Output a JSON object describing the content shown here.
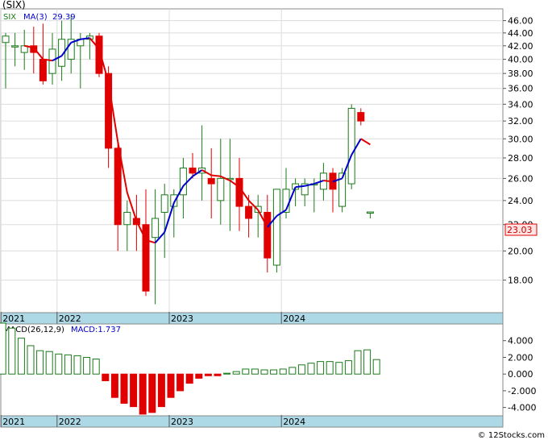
{
  "title": "(SIX)",
  "ma_label": "MA(3)",
  "ma_value": "29.39",
  "last_price_label": "23.03",
  "macd_label": "MACD(26,12,9)",
  "macd_value_label": "MACD:1.737",
  "watermark": "© 12Stocks.com",
  "colors": {
    "up": "#1a7a1a",
    "down": "#e00000",
    "ma_up": "#0000cc",
    "ma_down": "#e00000",
    "axis_band": "#add8e6",
    "grid": "#dcdcdc"
  },
  "chart_data": [
    {
      "type": "candlestick",
      "series_name": "SIX",
      "x_labels": [
        "2021",
        "2022",
        "2023",
        "2024"
      ],
      "x_label_index": [
        0,
        6,
        18,
        30
      ],
      "y_ticks": [
        "18.00",
        "20.00",
        "22.00",
        "24.00",
        "26.00",
        "28.00",
        "30.00",
        "32.00",
        "34.00",
        "36.00",
        "38.00",
        "40.00",
        "42.00",
        "44.00",
        "46.00"
      ],
      "ylim": [
        16,
        48
      ],
      "y_scale": "log",
      "grid": true,
      "ohlc": [
        [
          42.5,
          44.0,
          36.0,
          43.5
        ],
        [
          42.0,
          44.0,
          39.0,
          42.0
        ],
        [
          41.0,
          44.5,
          38.5,
          42.0
        ],
        [
          42.0,
          45.0,
          38.0,
          41.0
        ],
        [
          40.0,
          45.5,
          36.5,
          37.0
        ],
        [
          38.0,
          44.0,
          36.5,
          41.5
        ],
        [
          39.0,
          46.0,
          37.0,
          43.0
        ],
        [
          40.0,
          47.0,
          38.0,
          43.0
        ],
        [
          42.0,
          44.0,
          36.0,
          43.0
        ],
        [
          43.0,
          44.0,
          40.0,
          43.5
        ],
        [
          43.5,
          44.0,
          37.5,
          38.0
        ],
        [
          38.0,
          39.0,
          27.0,
          29.0
        ],
        [
          29.0,
          29.5,
          20.0,
          22.0
        ],
        [
          22.0,
          24.0,
          20.0,
          23.0
        ],
        [
          22.5,
          24.5,
          20.0,
          22.0
        ],
        [
          22.0,
          25.0,
          17.0,
          17.3
        ],
        [
          21.0,
          25.0,
          16.5,
          22.5
        ],
        [
          23.0,
          25.5,
          19.5,
          24.5
        ],
        [
          23.5,
          25.0,
          21.0,
          24.5
        ],
        [
          24.5,
          28.0,
          22.5,
          27.0
        ],
        [
          27.0,
          28.5,
          26.0,
          26.5
        ],
        [
          26.5,
          31.5,
          24.0,
          27.0
        ],
        [
          26.0,
          29.0,
          22.5,
          25.5
        ],
        [
          24.0,
          30.0,
          22.0,
          26.0
        ],
        [
          26.0,
          30.0,
          21.5,
          26.0
        ],
        [
          26.0,
          28.0,
          21.5,
          23.5
        ],
        [
          23.5,
          24.5,
          21.0,
          22.5
        ],
        [
          23.0,
          24.5,
          21.0,
          23.5
        ],
        [
          23.0,
          24.5,
          18.5,
          19.5
        ],
        [
          19.0,
          25.0,
          18.5,
          25.0
        ],
        [
          23.0,
          27.0,
          22.5,
          25.0
        ],
        [
          25.0,
          26.0,
          23.5,
          25.5
        ],
        [
          24.5,
          26.0,
          23.5,
          25.5
        ],
        [
          25.5,
          26.0,
          23.0,
          25.5
        ],
        [
          25.0,
          27.5,
          24.0,
          26.5
        ],
        [
          26.5,
          27.0,
          23.0,
          25.0
        ],
        [
          23.5,
          27.0,
          23.0,
          26.5
        ],
        [
          25.5,
          34.0,
          25.0,
          33.5
        ],
        [
          33.0,
          33.5,
          31.5,
          32.0
        ],
        [
          23.0,
          23.0,
          22.5,
          23.03
        ]
      ],
      "ma3": [
        null,
        null,
        42.0,
        41.7,
        40.0,
        39.8,
        40.5,
        42.5,
        43.0,
        43.2,
        41.5,
        36.8,
        29.7,
        24.7,
        22.3,
        20.8,
        20.6,
        21.4,
        23.8,
        25.3,
        26.2,
        26.8,
        26.3,
        26.2,
        25.8,
        25.2,
        24.0,
        23.2,
        21.8,
        22.7,
        23.2,
        25.2,
        25.3,
        25.5,
        25.8,
        25.7,
        26.0,
        28.3,
        30.0,
        29.39
      ]
    },
    {
      "type": "bar",
      "series_name": "MACD",
      "y_ticks": [
        "-4.000",
        "-2.000",
        "0.000",
        "2.000",
        "4.000"
      ],
      "ylim": [
        -5,
        6
      ],
      "grid": false,
      "values": [
        6.1,
        5.5,
        4.3,
        3.4,
        2.8,
        2.7,
        2.4,
        2.3,
        2.2,
        2.0,
        1.8,
        -0.8,
        -2.8,
        -3.5,
        -3.9,
        -4.8,
        -4.6,
        -3.9,
        -2.8,
        -2.0,
        -1.1,
        -0.5,
        -0.2,
        -0.2,
        0.1,
        0.3,
        0.6,
        0.6,
        0.5,
        0.5,
        0.6,
        0.8,
        1.1,
        1.3,
        1.5,
        1.5,
        1.4,
        1.6,
        2.8,
        2.9,
        1.737
      ]
    }
  ]
}
